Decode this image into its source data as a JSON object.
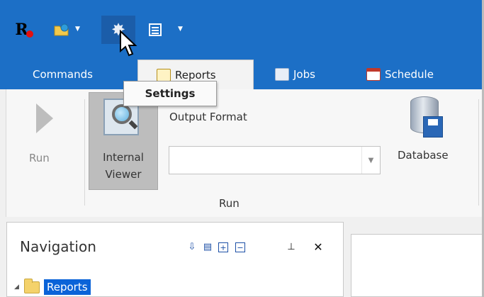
{
  "quick_access": {
    "app_logo_letter": "R",
    "icons": [
      "app-logo-icon",
      "open-file-icon",
      "settings-gear-icon",
      "layout-icon"
    ]
  },
  "tabs": [
    {
      "label": "Commands",
      "active": false
    },
    {
      "label": "Reports",
      "active": true
    },
    {
      "label": "Jobs",
      "active": false
    },
    {
      "label": "Schedule",
      "active": false
    }
  ],
  "ribbon": {
    "run_label": "Run",
    "internal_viewer_line1": "Internal",
    "internal_viewer_line2": "Viewer",
    "output_format_label": "Output Format",
    "output_format_value": "",
    "database_label": "Database",
    "group_label": "Run"
  },
  "tooltip": {
    "text": "Settings"
  },
  "navigation": {
    "title": "Navigation",
    "tree": [
      {
        "label": "Reports",
        "selected": true
      }
    ]
  },
  "colors": {
    "titlebar": "#1c6fc6",
    "selection": "#0a63d8"
  }
}
